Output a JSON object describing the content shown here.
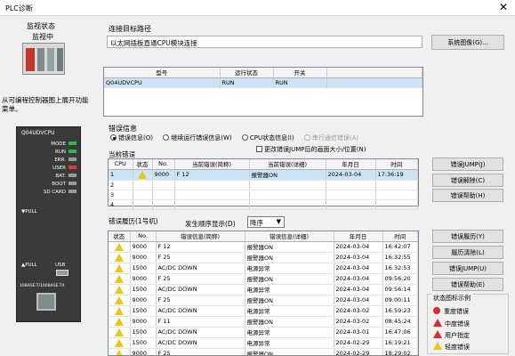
{
  "window_title": "PLC诊断",
  "monitor": {
    "group_label": "监视状态",
    "status": "监视中"
  },
  "side_hint": "从可编程控制器图上展开功能菜单。",
  "target": {
    "group_label": "连接目标路径",
    "value": "以太网插板直通CPU模块连接",
    "button": "系统图像(G)..."
  },
  "module_table": {
    "headers": [
      "型号",
      "运行状态",
      "开关"
    ],
    "rows": [
      [
        "Q04UDVCPU",
        "RUN",
        "RUN"
      ]
    ]
  },
  "cpu": {
    "model": "Q04UDVCPU",
    "leds": [
      {
        "label": "MODE",
        "color": "#2db84a"
      },
      {
        "label": "RUN",
        "color": "#2db84a"
      },
      {
        "label": "ERR.",
        "color": "#9a9a9a"
      },
      {
        "label": "USER",
        "color": "#e23b3b"
      },
      {
        "label": "BAT.",
        "color": "#9a9a9a"
      },
      {
        "label": "BOOT",
        "color": "#9a9a9a"
      },
      {
        "label": "SD CARD",
        "color": "#9a9a9a"
      }
    ],
    "pull1": "▼PULL",
    "pull2": "▲PULL",
    "usb": "USB",
    "eth": "10BASE-T/100BASE-TX"
  },
  "error_info": {
    "group_label": "错误信息",
    "radios": [
      {
        "label": "错误信息(O)",
        "checked": true,
        "disabled": false
      },
      {
        "label": "继续运行错误信息(W)",
        "checked": false,
        "disabled": false
      },
      {
        "label": "CPU状态信息(I)",
        "checked": false,
        "disabled": false
      },
      {
        "label": "串行通信错误(A)",
        "checked": false,
        "disabled": true
      }
    ],
    "current_label": "当前错误",
    "resize_check": "更改错误JUMP后的画面大小/位置(N)",
    "headers": [
      "CPU",
      "状态",
      "No.",
      "当前错误(简称)",
      "当前错误(详细)",
      "年月日",
      "时间"
    ],
    "rows": [
      {
        "cpu": "1",
        "warn": true,
        "no": "9000",
        "short": "F 12",
        "detail": "报警器ON",
        "date": "2024-03-04",
        "time": "17:36:19"
      },
      {
        "cpu": "2",
        "warn": false,
        "no": "",
        "short": "",
        "detail": "",
        "date": "",
        "time": ""
      },
      {
        "cpu": "3",
        "warn": false,
        "no": "",
        "short": "",
        "detail": "",
        "date": "",
        "time": ""
      },
      {
        "cpu": "4",
        "warn": false,
        "no": "",
        "short": "",
        "detail": "",
        "date": "",
        "time": ""
      }
    ],
    "buttons": [
      "错误JUMP(J)",
      "错误解除(C)",
      "错误帮助(H)"
    ]
  },
  "history": {
    "label": "错误履历(1号机)",
    "order_label": "发生顺序显示(D)",
    "order_value": "降序",
    "headers": [
      "状态",
      "No.",
      "错误信息(简称)",
      "错误信息(详细)",
      "年月日",
      "时间"
    ],
    "rows": [
      {
        "no": "9000",
        "short": "F 12",
        "detail": "报警器ON",
        "date": "2024-03-04",
        "time": "16:42:07"
      },
      {
        "no": "9000",
        "short": "F 25",
        "detail": "报警器ON",
        "date": "2024-03-04",
        "time": "16:32:55"
      },
      {
        "no": "1500",
        "short": "AC/DC DOWN",
        "detail": "电源异常",
        "date": "2024-03-04",
        "time": "16:32:53"
      },
      {
        "no": "9000",
        "short": "F 25",
        "detail": "报警器ON",
        "date": "2024-03-04",
        "time": "09:56:20"
      },
      {
        "no": "1500",
        "short": "AC/DC DOWN",
        "detail": "电源异常",
        "date": "2024-03-04",
        "time": "09:56:14"
      },
      {
        "no": "9000",
        "short": "F 25",
        "detail": "报警器ON",
        "date": "2024-03-04",
        "time": "09:00:11"
      },
      {
        "no": "1500",
        "short": "AC/DC DOWN",
        "detail": "电源异常",
        "date": "2024-03-02",
        "time": "16:59:23"
      },
      {
        "no": "9000",
        "short": "F 11",
        "detail": "报警器ON",
        "date": "2024-03-02",
        "time": "08:45:24"
      },
      {
        "no": "1500",
        "short": "AC/DC DOWN",
        "detail": "电源异常",
        "date": "2024-03-01",
        "time": "16:47:06"
      },
      {
        "no": "1500",
        "short": "AC/DC DOWN",
        "detail": "电源异常",
        "date": "2024-02-29",
        "time": "16:19:21"
      },
      {
        "no": "9000",
        "short": "F 25",
        "detail": "报警器ON",
        "date": "2024-02-29",
        "time": "18:29:02"
      }
    ],
    "buttons": [
      "错误履历(Y)",
      "履历清除(L)",
      "错误JUMP(U)",
      "错误帮助(E)"
    ]
  },
  "legend": {
    "title": "状态图标示例",
    "items": [
      {
        "label": "重度错误",
        "icon": "stop-icon",
        "color": "#d92b2b"
      },
      {
        "label": "中度错误",
        "icon": "warning-red-icon",
        "color": "#d92b2b"
      },
      {
        "label": "用户指定",
        "icon": "warning-red-icon",
        "color": "#d92b2b"
      },
      {
        "label": "轻度错误",
        "icon": "warning-yellow-icon",
        "color": "#f1c40f"
      }
    ]
  }
}
